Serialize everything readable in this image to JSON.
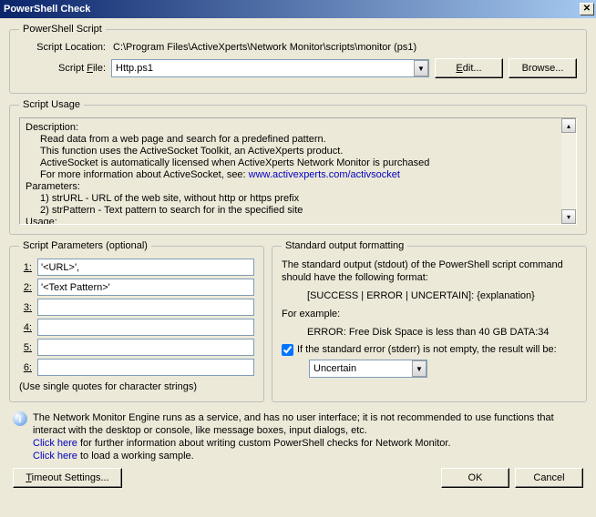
{
  "title": "PowerShell Check",
  "script_group": {
    "legend": "PowerShell Script",
    "location_label": "Script Location:",
    "location_value": "C:\\Program Files\\ActiveXperts\\Network Monitor\\scripts\\monitor (ps1)",
    "file_label": "Script File:",
    "file_value": "Http.ps1",
    "edit_btn": "Edit...",
    "browse_btn": "Browse..."
  },
  "usage_group": {
    "legend": "Script Usage",
    "desc_label": "Description:",
    "desc_l1": "Read data from a web page and search for a predefined pattern.",
    "desc_l2": "This function uses the ActiveSocket Toolkit, an ActiveXperts product.",
    "desc_l3": "ActiveSocket is automatically licensed when ActiveXperts Network Monitor is purchased",
    "desc_l4_pre": "For more information about ActiveSocket, see: ",
    "desc_l4_link": "www.activexperts.com/activsocket",
    "params_label": "Parameters:",
    "param1": "1) strURL - URL of the web site, without http or https prefix",
    "param2": "2) strPattern - Text pattern to search for in the specified site",
    "usage_label": "Usage:"
  },
  "params_group": {
    "legend": "Script Parameters (optional)",
    "labels": [
      "1:",
      "2:",
      "3:",
      "4:",
      "5:",
      "6:"
    ],
    "values": [
      "'<URL>',",
      "'<Text Pattern>'",
      "",
      "",
      "",
      ""
    ],
    "hint": "(Use single quotes for character strings)"
  },
  "stdout_group": {
    "legend": "Standard output formatting",
    "l1": "The standard output (stdout) of the PowerShell script command should have the following format:",
    "l2": "[SUCCESS | ERROR | UNCERTAIN]: {explanation}",
    "l3": "For example:",
    "l4": "ERROR: Free Disk Space is less than 40 GB DATA:34",
    "checkbox_label": "If the standard error (stderr) is not empty, the result will be:",
    "dropdown_value": "Uncertain"
  },
  "info": {
    "l1": "The Network Monitor Engine runs as a service, and has no user interface; it is not recommended to use functions that interact with the desktop or console, like message boxes, input dialogs, etc.",
    "link1_a": "Click here",
    "link1_b": " for further information about writing custom PowerShell checks for Network Monitor.",
    "link2_a": "Click here",
    "link2_b": " to load a working sample."
  },
  "buttons": {
    "timeout": "Timeout Settings...",
    "ok": "OK",
    "cancel": "Cancel"
  }
}
